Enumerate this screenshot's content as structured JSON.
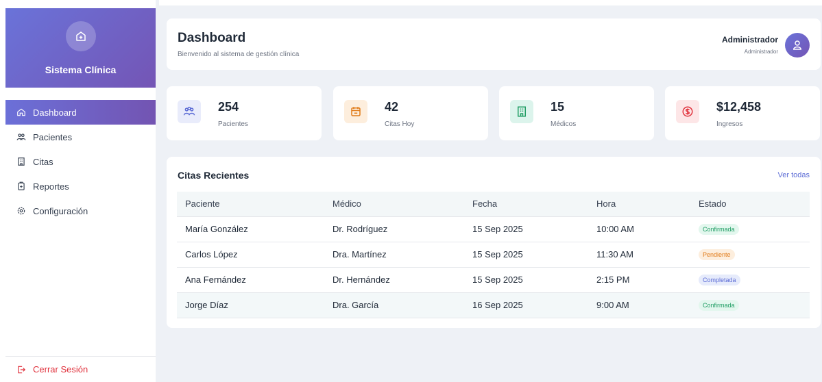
{
  "sidebar": {
    "brand_title": "Sistema Clínica",
    "items": [
      {
        "label": "Dashboard",
        "icon": "home-icon",
        "active": true
      },
      {
        "label": "Pacientes",
        "icon": "users-icon"
      },
      {
        "label": "Citas",
        "icon": "calendar-building-icon"
      },
      {
        "label": "Reportes",
        "icon": "clipboard-icon"
      },
      {
        "label": "Configuración",
        "icon": "gear-icon"
      }
    ],
    "logout_label": "Cerrar Sesión"
  },
  "header": {
    "title": "Dashboard",
    "subtitle": "Bienvenido al sistema de gestión clínica",
    "user_name": "Administrador",
    "user_role": "Administrador"
  },
  "stats": [
    {
      "value": "254",
      "label": "Pacientes",
      "icon": "users-icon",
      "bg": "#e9ecfb",
      "fg": "#5b6bd5"
    },
    {
      "value": "42",
      "label": "Citas Hoy",
      "icon": "calendar-icon",
      "bg": "#fdeedd",
      "fg": "#e07a17"
    },
    {
      "value": "15",
      "label": "Médicos",
      "icon": "building-icon",
      "bg": "#dcf4ec",
      "fg": "#1f9d63"
    },
    {
      "value": "$12,458",
      "label": "Ingresos",
      "icon": "dollar-icon",
      "bg": "#fde6e7",
      "fg": "#e0313c"
    }
  ],
  "recent": {
    "title": "Citas Recientes",
    "view_all": "Ver todas",
    "columns": [
      "Paciente",
      "Médico",
      "Fecha",
      "Hora",
      "Estado"
    ],
    "rows": [
      {
        "paciente": "María González",
        "medico": "Dr. Rodríguez",
        "fecha": "15 Sep 2025",
        "hora": "10:00 AM",
        "estado": "Confirmada",
        "kind": "conf"
      },
      {
        "paciente": "Carlos López",
        "medico": "Dra. Martínez",
        "fecha": "15 Sep 2025",
        "hora": "11:30 AM",
        "estado": "Pendiente",
        "kind": "pend"
      },
      {
        "paciente": "Ana Fernández",
        "medico": "Dr. Hernández",
        "fecha": "15 Sep 2025",
        "hora": "2:15 PM",
        "estado": "Completada",
        "kind": "comp"
      },
      {
        "paciente": "Jorge Díaz",
        "medico": "Dra. García",
        "fecha": "16 Sep 2025",
        "hora": "9:00 AM",
        "estado": "Confirmada",
        "kind": "conf"
      }
    ]
  },
  "colors": {
    "accent": "#6a6fd6",
    "danger": "#e0313c"
  }
}
